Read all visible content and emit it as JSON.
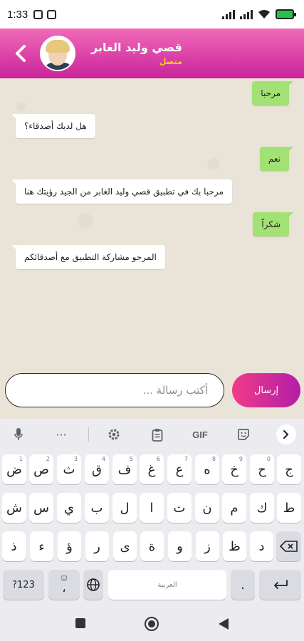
{
  "status_bar": {
    "time": "1:33",
    "battery_level_pct": 100,
    "icons": [
      "square-notification-icon",
      "square-notification-icon",
      "signal-icon",
      "signal-icon",
      "wifi-icon",
      "battery-charging-icon"
    ]
  },
  "header": {
    "contact_name": "قصي وليد الغابر",
    "status": "متصل",
    "back_icon": "chevron-left-icon",
    "avatar": "contact-avatar-photo",
    "gradient_colors": [
      "#f06bb8",
      "#c9239a"
    ],
    "status_color": "#f7d417"
  },
  "messages": [
    {
      "dir": "out",
      "text": "مرحبا"
    },
    {
      "dir": "in",
      "text": "هل لديك أصدقاء؟"
    },
    {
      "dir": "out",
      "text": "نعم"
    },
    {
      "dir": "in",
      "text": "مرحبا بك في تطبيق قصي وليد الغابر من الجيد رؤيتك هنا"
    },
    {
      "dir": "out",
      "text": "شكراً"
    },
    {
      "dir": "in",
      "text": "المرجو مشاركة التطبيق مع أصدقائكم"
    }
  ],
  "bubble_colors": {
    "outgoing": "#a2e173",
    "incoming": "#ffffff"
  },
  "composer": {
    "placeholder": "أكتب رسالة ...",
    "send_label": "إرسال",
    "send_gradient": [
      "#f23a8a",
      "#b21fa6"
    ]
  },
  "keyboard": {
    "toolbar": [
      "mic-icon",
      "more-icon",
      "settings-icon",
      "clipboard-icon",
      "GIF",
      "sticker-icon",
      "chevron-right-icon"
    ],
    "gif_label": "GIF",
    "row1": [
      {
        "k": "ض",
        "n": "1"
      },
      {
        "k": "ص",
        "n": "2"
      },
      {
        "k": "ث",
        "n": "3"
      },
      {
        "k": "ق",
        "n": "4"
      },
      {
        "k": "ف",
        "n": "5"
      },
      {
        "k": "غ",
        "n": "6"
      },
      {
        "k": "ع",
        "n": "7"
      },
      {
        "k": "ه",
        "n": "8"
      },
      {
        "k": "خ",
        "n": "9"
      },
      {
        "k": "ح",
        "n": "0"
      },
      {
        "k": "ج",
        "n": ""
      }
    ],
    "row2": [
      "ش",
      "س",
      "ي",
      "ب",
      "ل",
      "ا",
      "ت",
      "ن",
      "م",
      "ك",
      "ط"
    ],
    "row3": [
      "ذ",
      "ء",
      "ؤ",
      "ر",
      "ى",
      "ة",
      "و",
      "ز",
      "ظ",
      "د"
    ],
    "bottom": {
      "symbols_label": "?123",
      "emoji_label": "☺",
      "comma_label": "،",
      "space_label": "العربية",
      "period_label": ".",
      "enter_icon": "enter-arrow-icon",
      "globe_icon": "globe-icon",
      "backspace_icon": "backspace-icon"
    }
  },
  "nav_bar": {
    "icons": [
      "recent-apps-square-icon",
      "home-circle-icon",
      "back-triangle-icon"
    ]
  }
}
